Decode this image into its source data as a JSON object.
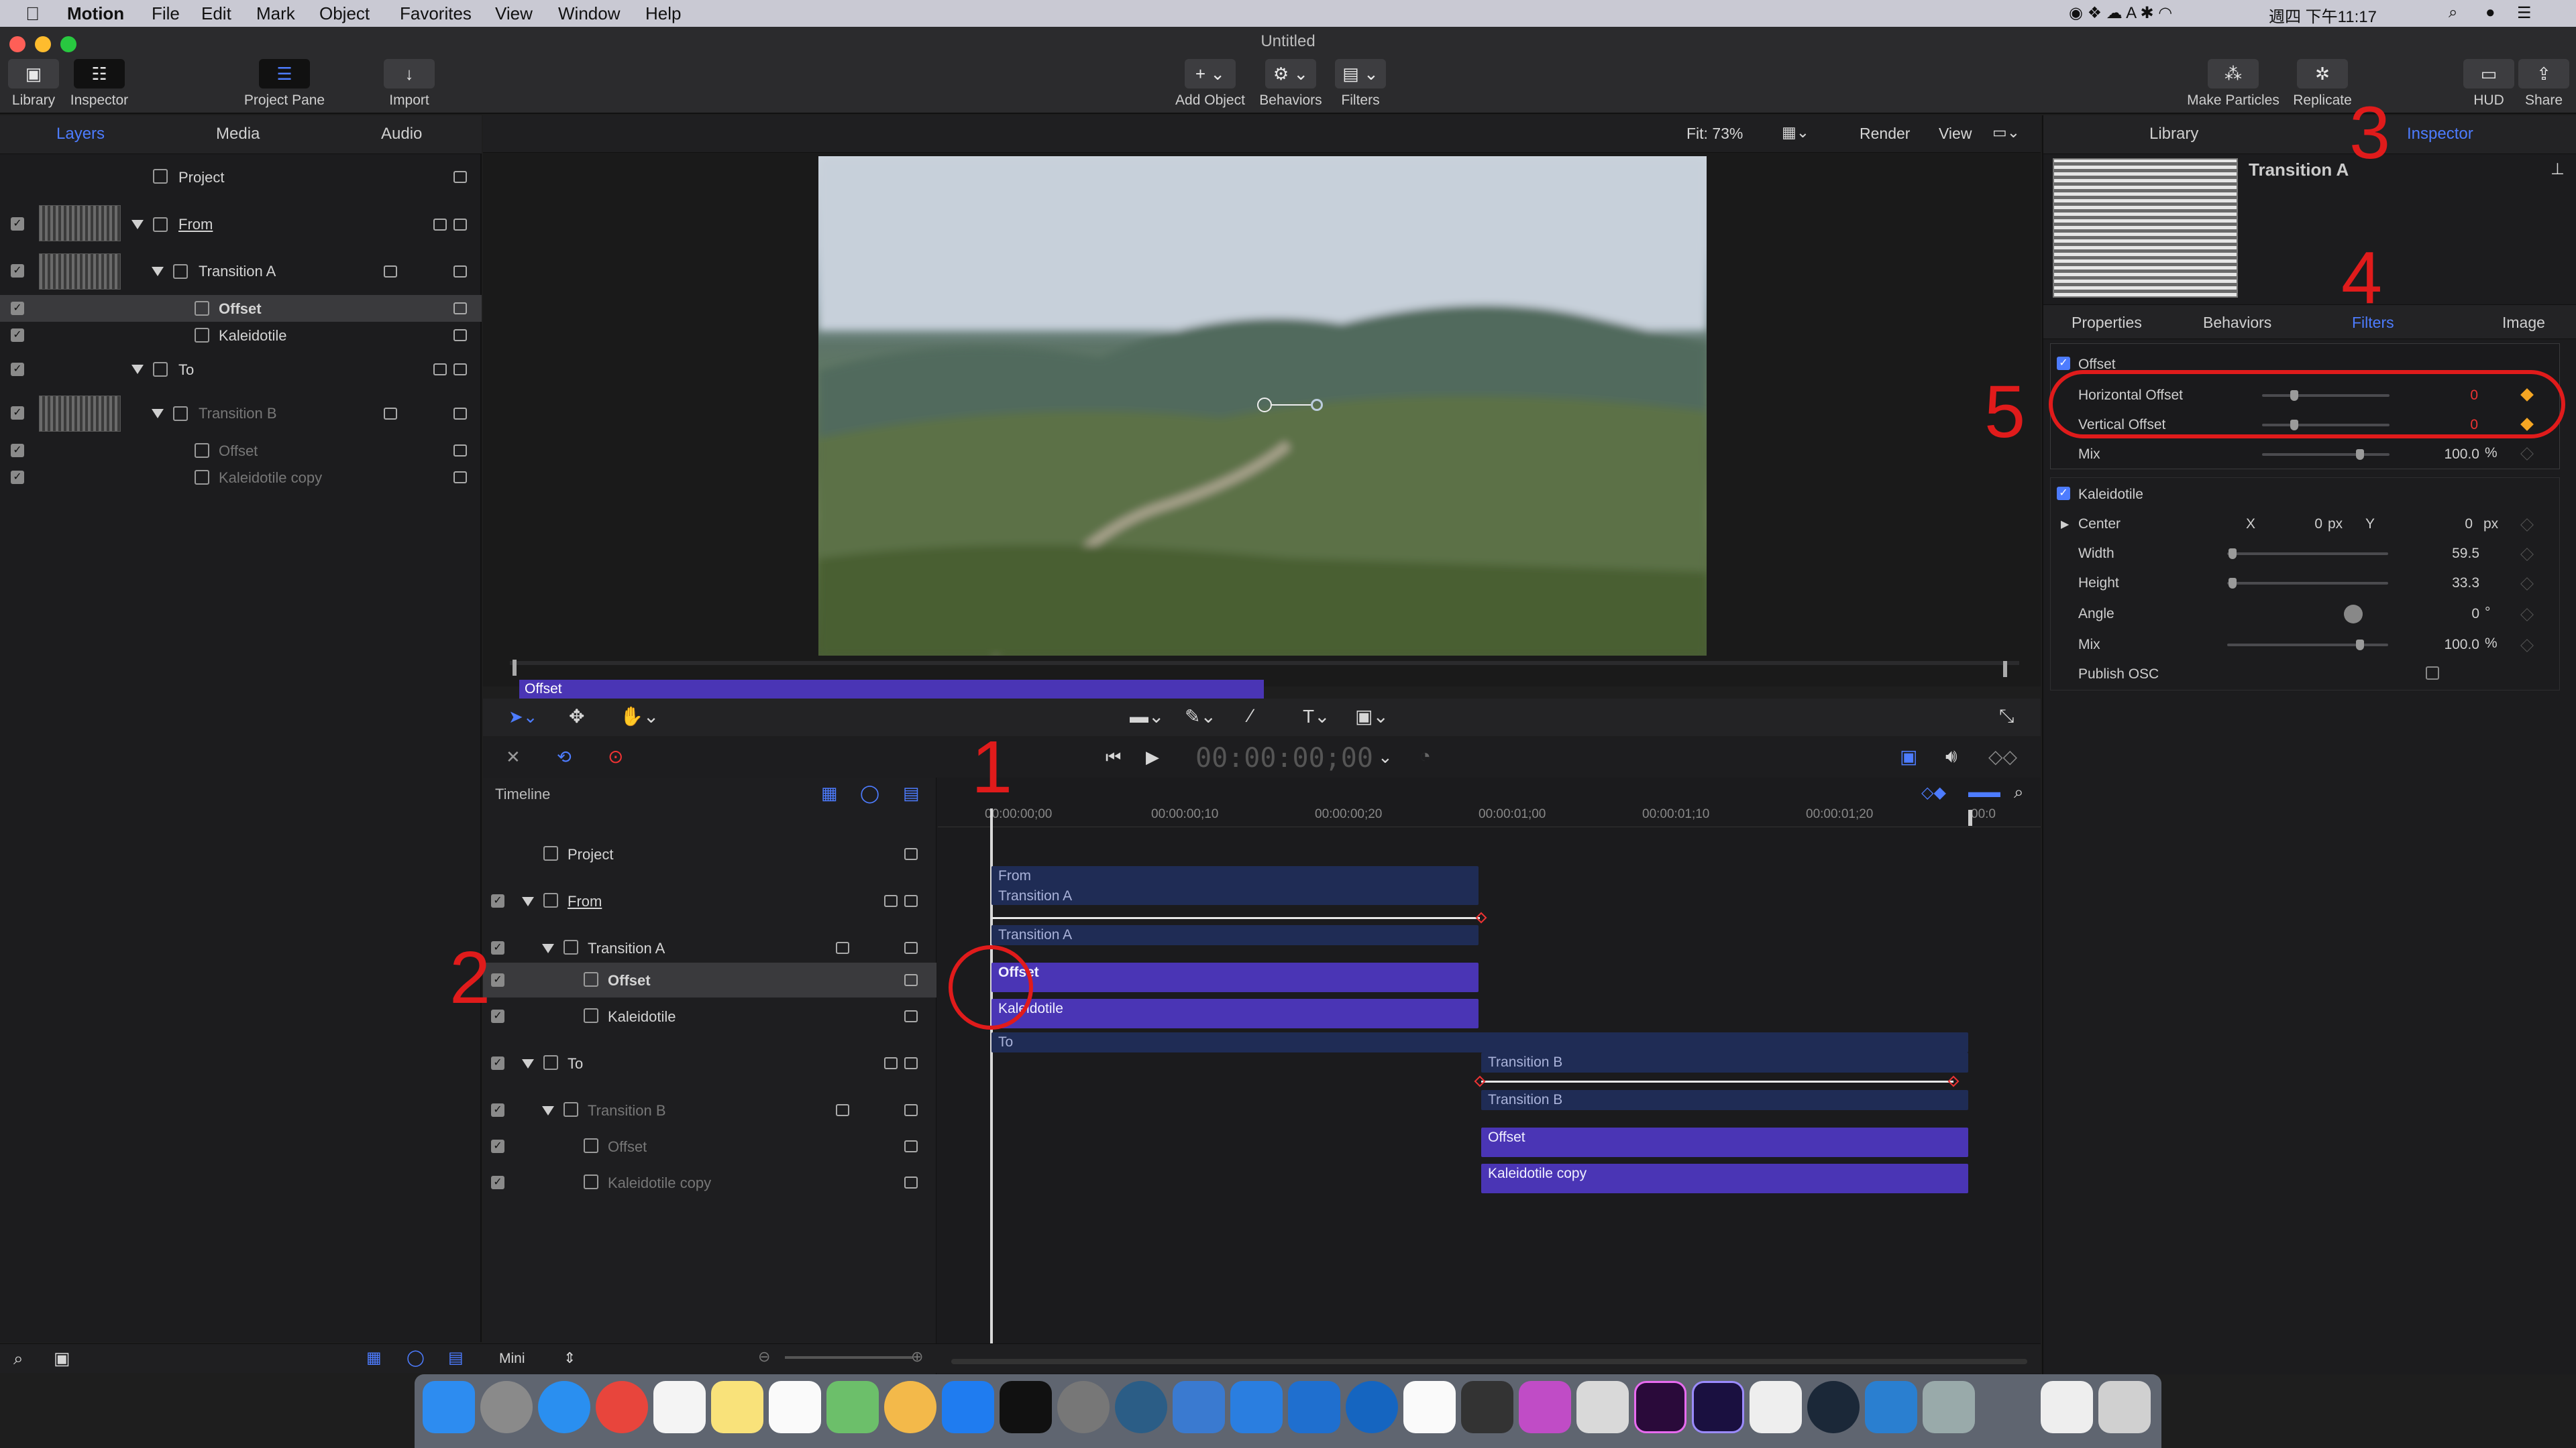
{
  "menubar": {
    "app": "Motion",
    "items": [
      "File",
      "Edit",
      "Mark",
      "Object",
      "Favorites",
      "View",
      "Window",
      "Help"
    ],
    "clock": "週四 下午11:17"
  },
  "window": {
    "title": "Untitled"
  },
  "toolbar": {
    "library": "Library",
    "inspector": "Inspector",
    "project_pane": "Project Pane",
    "import": "Import",
    "add_object": "Add Object",
    "behaviors": "Behaviors",
    "filters": "Filters",
    "make_particles": "Make Particles",
    "replicate": "Replicate",
    "hud": "HUD",
    "share": "Share"
  },
  "left_tabs": [
    "Layers",
    "Media",
    "Audio"
  ],
  "layers": {
    "project": "Project",
    "rows": [
      {
        "label": "From"
      },
      {
        "label": "Transition A"
      },
      {
        "label": "Offset"
      },
      {
        "label": "Kaleidotile"
      },
      {
        "label": "To"
      },
      {
        "label": "Transition B"
      },
      {
        "label": "Offset"
      },
      {
        "label": "Kaleidotile copy"
      }
    ]
  },
  "canvas_bar": {
    "fit": "Fit: 73%",
    "render": "Render",
    "view": "View"
  },
  "mini_timeline": {
    "label": "Offset"
  },
  "transport": {
    "timecode": "00:00:00;00"
  },
  "timeline": {
    "title": "Timeline",
    "ruler": [
      "00:00:00;00",
      "00:00:00;10",
      "00:00:00;20",
      "00:00:01;00",
      "00:00:01;10",
      "00:00:01;20",
      "00:0"
    ],
    "project": "Project",
    "rows": [
      "From",
      "Transition A",
      "Offset",
      "Kaleidotile",
      "To",
      "Transition B",
      "Offset",
      "Kaleidotile copy"
    ],
    "bars": {
      "from": "From",
      "transition_a_top": "Transition A",
      "transition_a": "Transition A",
      "offset_a": "Offset",
      "kaleido_a": "Kaleidotile",
      "to": "To",
      "transition_b_top": "Transition B",
      "transition_b": "Transition B",
      "offset_b": "Offset",
      "kaleido_b": "Kaleidotile copy"
    },
    "footer": "Mini"
  },
  "inspector": {
    "top_tabs": [
      "Library",
      "Inspector"
    ],
    "object_name": "Transition A",
    "tabs": [
      "Properties",
      "Behaviors",
      "Filters",
      "Image"
    ],
    "offset": {
      "name": "Offset",
      "horizontal_label": "Horizontal Offset",
      "horizontal_value": "0",
      "vertical_label": "Vertical Offset",
      "vertical_value": "0",
      "mix_label": "Mix",
      "mix_value": "100.0",
      "mix_unit": "%"
    },
    "kaleidotile": {
      "name": "Kaleidotile",
      "center_label": "Center",
      "x_label": "X",
      "x_value": "0",
      "x_unit": "px",
      "y_label": "Y",
      "y_value": "0",
      "y_unit": "px",
      "width_label": "Width",
      "width_value": "59.5",
      "height_label": "Height",
      "height_value": "33.3",
      "angle_label": "Angle",
      "angle_value": "0",
      "angle_unit": "°",
      "mix_label": "Mix",
      "mix_value": "100.0",
      "mix_unit": "%",
      "publish_label": "Publish OSC"
    }
  },
  "annotations": [
    "1",
    "2",
    "3",
    "4",
    "5"
  ],
  "colors": {
    "accent": "#4d7cff",
    "filter_bar": "#4a35b5",
    "group_bar": "#1f2c55",
    "annotation": "#e01b1b",
    "keyframe": "#f5a623"
  }
}
